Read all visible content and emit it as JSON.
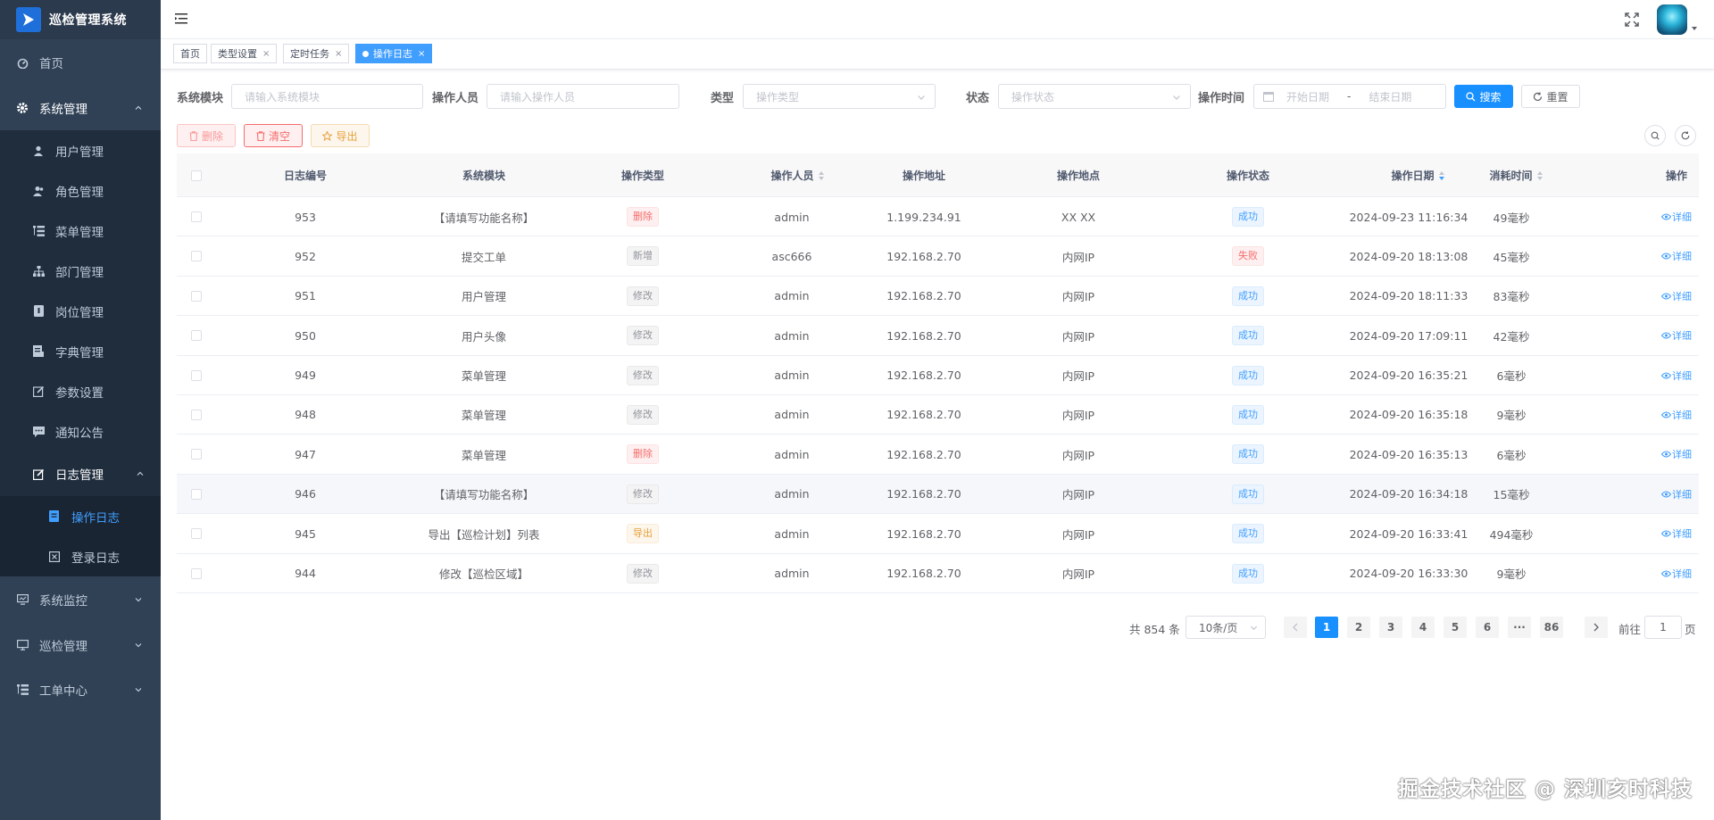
{
  "app": {
    "title": "巡检管理系统"
  },
  "sidebar": {
    "items": [
      {
        "label": "首页"
      },
      {
        "label": "系统管理"
      },
      {
        "label": "用户管理"
      },
      {
        "label": "角色管理"
      },
      {
        "label": "菜单管理"
      },
      {
        "label": "部门管理"
      },
      {
        "label": "岗位管理"
      },
      {
        "label": "字典管理"
      },
      {
        "label": "参数设置"
      },
      {
        "label": "通知公告"
      },
      {
        "label": "日志管理"
      },
      {
        "label": "操作日志"
      },
      {
        "label": "登录日志"
      },
      {
        "label": "系统监控"
      },
      {
        "label": "巡检管理"
      },
      {
        "label": "工单中心"
      }
    ]
  },
  "tags": [
    {
      "label": "首页"
    },
    {
      "label": "类型设置"
    },
    {
      "label": "定时任务"
    },
    {
      "label": "操作日志"
    }
  ],
  "filters": {
    "module_label": "系统模块",
    "module_placeholder": "请输入系统模块",
    "operator_label": "操作人员",
    "operator_placeholder": "请输入操作人员",
    "type_label": "类型",
    "type_placeholder": "操作类型",
    "status_label": "状态",
    "status_placeholder": "操作状态",
    "time_label": "操作时间",
    "start_placeholder": "开始日期",
    "range_sep": "-",
    "end_placeholder": "结束日期",
    "search_label": "搜索",
    "reset_label": "重置"
  },
  "toolbar": {
    "delete_label": "删除",
    "clear_label": "清空",
    "export_label": "导出"
  },
  "table": {
    "headers": [
      "日志编号",
      "系统模块",
      "操作类型",
      "操作人员",
      "操作地址",
      "操作地点",
      "操作状态",
      "操作日期",
      "消耗时间",
      "操作"
    ],
    "detail_label": "详细",
    "rows": [
      {
        "id": "953",
        "module": "【请填写功能名称】",
        "type": "删除",
        "type_style": "del",
        "user": "admin",
        "ip": "1.199.234.91",
        "loc": "XX XX",
        "status": "成功",
        "status_style": "ok",
        "date": "2024-09-23 11:16:34",
        "cost": "49毫秒"
      },
      {
        "id": "952",
        "module": "提交工单",
        "type": "新增",
        "type_style": "add",
        "user": "asc666",
        "ip": "192.168.2.70",
        "loc": "内网IP",
        "status": "失败",
        "status_style": "fail",
        "date": "2024-09-20 18:13:08",
        "cost": "45毫秒"
      },
      {
        "id": "951",
        "module": "用户管理",
        "type": "修改",
        "type_style": "edit",
        "user": "admin",
        "ip": "192.168.2.70",
        "loc": "内网IP",
        "status": "成功",
        "status_style": "ok",
        "date": "2024-09-20 18:11:33",
        "cost": "83毫秒"
      },
      {
        "id": "950",
        "module": "用户头像",
        "type": "修改",
        "type_style": "edit",
        "user": "admin",
        "ip": "192.168.2.70",
        "loc": "内网IP",
        "status": "成功",
        "status_style": "ok",
        "date": "2024-09-20 17:09:11",
        "cost": "42毫秒"
      },
      {
        "id": "949",
        "module": "菜单管理",
        "type": "修改",
        "type_style": "edit",
        "user": "admin",
        "ip": "192.168.2.70",
        "loc": "内网IP",
        "status": "成功",
        "status_style": "ok",
        "date": "2024-09-20 16:35:21",
        "cost": "6毫秒"
      },
      {
        "id": "948",
        "module": "菜单管理",
        "type": "修改",
        "type_style": "edit",
        "user": "admin",
        "ip": "192.168.2.70",
        "loc": "内网IP",
        "status": "成功",
        "status_style": "ok",
        "date": "2024-09-20 16:35:18",
        "cost": "9毫秒"
      },
      {
        "id": "947",
        "module": "菜单管理",
        "type": "删除",
        "type_style": "del",
        "user": "admin",
        "ip": "192.168.2.70",
        "loc": "内网IP",
        "status": "成功",
        "status_style": "ok",
        "date": "2024-09-20 16:35:13",
        "cost": "6毫秒"
      },
      {
        "id": "946",
        "module": "【请填写功能名称】",
        "type": "修改",
        "type_style": "edit",
        "user": "admin",
        "ip": "192.168.2.70",
        "loc": "内网IP",
        "status": "成功",
        "status_style": "ok",
        "date": "2024-09-20 16:34:18",
        "cost": "15毫秒"
      },
      {
        "id": "945",
        "module": "导出【巡检计划】列表",
        "type": "导出",
        "type_style": "exp",
        "user": "admin",
        "ip": "192.168.2.70",
        "loc": "内网IP",
        "status": "成功",
        "status_style": "ok",
        "date": "2024-09-20 16:33:41",
        "cost": "494毫秒"
      },
      {
        "id": "944",
        "module": "修改【巡检区域】",
        "type": "修改",
        "type_style": "edit",
        "user": "admin",
        "ip": "192.168.2.70",
        "loc": "内网IP",
        "status": "成功",
        "status_style": "ok",
        "date": "2024-09-20 16:33:30",
        "cost": "9毫秒"
      }
    ]
  },
  "pagination": {
    "total_text": "共 854 条",
    "page_size": "10条/页",
    "pages": [
      "1",
      "2",
      "3",
      "4",
      "5",
      "6",
      "···",
      "86"
    ],
    "jump_prefix": "前往",
    "jump_value": "1",
    "jump_suffix": "页"
  },
  "watermark": "掘金技术社区 @ 深圳亥时科技",
  "colors": {
    "sidebar": "#304156",
    "primary": "#1890ff"
  }
}
